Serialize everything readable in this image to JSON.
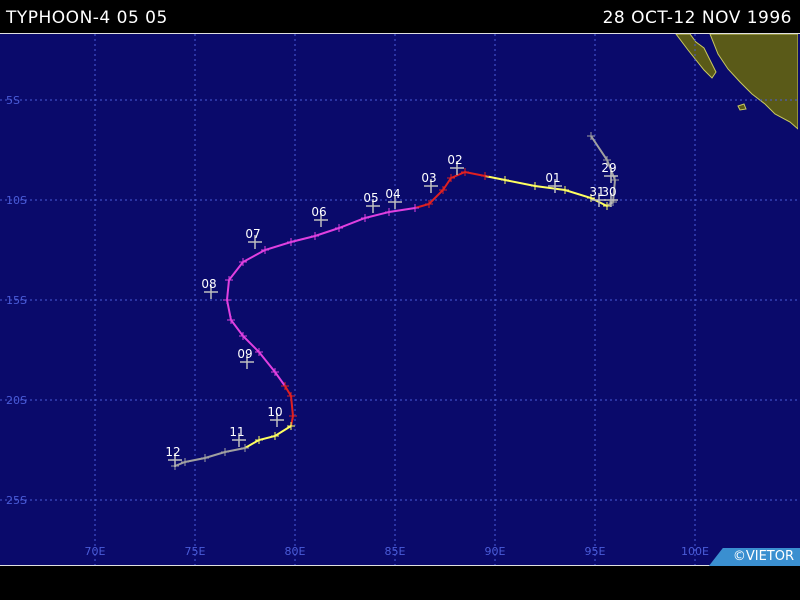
{
  "header": {
    "storm_name": "TYPHOON-4 05 05",
    "date_range": "28 OCT-12 NOV 1996"
  },
  "credit": "©VIETOR",
  "map": {
    "background_color": "#0a0a6b",
    "land_color": "#5a5a18",
    "grid_color": "#4a5cd8",
    "lat_labels": [
      {
        "lat": -5,
        "text": "5S"
      },
      {
        "lat": -10,
        "text": "10S"
      },
      {
        "lat": -15,
        "text": "15S"
      },
      {
        "lat": -20,
        "text": "20S"
      },
      {
        "lat": -25,
        "text": "25S"
      }
    ],
    "lon_labels": [
      {
        "lon": 70,
        "text": "70E"
      },
      {
        "lon": 75,
        "text": "75E"
      },
      {
        "lon": 80,
        "text": "80E"
      },
      {
        "lon": 85,
        "text": "85E"
      },
      {
        "lon": 90,
        "text": "90E"
      },
      {
        "lon": 95,
        "text": "95E"
      },
      {
        "lon": 100,
        "text": "100E"
      }
    ],
    "intensity_colors": {
      "gray": "#a0a0a0",
      "yellow": "#ffff60",
      "red": "#e02020",
      "magenta": "#e040e0"
    }
  },
  "track": {
    "segments": [
      {
        "color": "gray",
        "points": [
          [
            94.8,
            -6.8
          ],
          [
            95.6,
            -8.0
          ],
          [
            96.0,
            -9.0
          ],
          [
            95.9,
            -10.1
          ],
          [
            95.6,
            -10.3
          ]
        ]
      },
      {
        "color": "yellow",
        "points": [
          [
            95.6,
            -10.3
          ],
          [
            94.8,
            -9.9
          ],
          [
            93.5,
            -9.5
          ],
          [
            92.0,
            -9.3
          ],
          [
            90.5,
            -9.0
          ],
          [
            89.5,
            -8.8
          ]
        ]
      },
      {
        "color": "red",
        "points": [
          [
            89.5,
            -8.8
          ],
          [
            88.5,
            -8.6
          ],
          [
            87.8,
            -8.9
          ],
          [
            87.4,
            -9.5
          ],
          [
            86.7,
            -10.2
          ],
          [
            86.0,
            -10.4
          ]
        ]
      },
      {
        "color": "magenta",
        "points": [
          [
            86.0,
            -10.4
          ],
          [
            84.7,
            -10.6
          ],
          [
            83.5,
            -10.9
          ],
          [
            82.2,
            -11.4
          ],
          [
            81.0,
            -11.8
          ],
          [
            79.8,
            -12.1
          ],
          [
            78.5,
            -12.5
          ],
          [
            77.4,
            -13.1
          ],
          [
            76.7,
            -14.0
          ],
          [
            76.6,
            -15.0
          ],
          [
            76.8,
            -16.0
          ],
          [
            77.4,
            -16.8
          ],
          [
            78.2,
            -17.6
          ],
          [
            79.0,
            -18.6
          ],
          [
            79.5,
            -19.3
          ]
        ]
      },
      {
        "color": "red",
        "points": [
          [
            79.5,
            -19.3
          ],
          [
            79.8,
            -19.8
          ],
          [
            79.9,
            -20.8
          ],
          [
            79.8,
            -21.3
          ]
        ]
      },
      {
        "color": "yellow",
        "points": [
          [
            79.8,
            -21.3
          ],
          [
            79.0,
            -21.8
          ],
          [
            78.2,
            -22.0
          ],
          [
            77.5,
            -22.4
          ]
        ]
      },
      {
        "color": "gray",
        "points": [
          [
            77.5,
            -22.4
          ],
          [
            76.5,
            -22.6
          ],
          [
            75.5,
            -22.9
          ],
          [
            74.5,
            -23.1
          ],
          [
            74.0,
            -23.3
          ]
        ]
      }
    ],
    "day_labels": [
      {
        "text": "29",
        "lon": 95.8,
        "lat": -8.8
      },
      {
        "text": "30",
        "lon": 95.8,
        "lat": -10.0
      },
      {
        "text": "31",
        "lon": 95.2,
        "lat": -10.0
      },
      {
        "text": "01",
        "lon": 93.0,
        "lat": -9.3
      },
      {
        "text": "02",
        "lon": 88.1,
        "lat": -8.4
      },
      {
        "text": "03",
        "lon": 86.8,
        "lat": -9.3
      },
      {
        "text": "04",
        "lon": 85.0,
        "lat": -10.1
      },
      {
        "text": "05",
        "lon": 83.9,
        "lat": -10.3
      },
      {
        "text": "06",
        "lon": 81.3,
        "lat": -11.0
      },
      {
        "text": "07",
        "lon": 78.0,
        "lat": -12.1
      },
      {
        "text": "08",
        "lon": 75.8,
        "lat": -14.6
      },
      {
        "text": "09",
        "lon": 77.6,
        "lat": -18.1
      },
      {
        "text": "10",
        "lon": 79.1,
        "lat": -21.0
      },
      {
        "text": "11",
        "lon": 77.2,
        "lat": -22.0
      },
      {
        "text": "12",
        "lon": 74.0,
        "lat": -23.0
      }
    ]
  }
}
